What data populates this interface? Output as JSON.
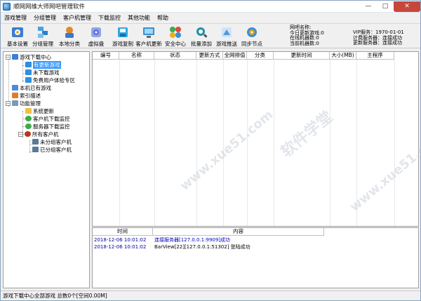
{
  "window": {
    "title": "顺网网维大师网吧管理软件"
  },
  "menu": [
    "游戏管理",
    "分组管理",
    "客户机管理",
    "下载监控",
    "其他功能",
    "帮助"
  ],
  "toolbar": {
    "buttons": [
      {
        "label": "基本设置",
        "icon": "gear-icon",
        "color": "#3b7dd8"
      },
      {
        "label": "分组管理",
        "icon": "group-icon",
        "color": "#4aa0e0"
      },
      {
        "label": "本地分类",
        "icon": "category-icon",
        "color": "#e08a2c"
      },
      {
        "label": "虚拟盘",
        "icon": "disk-icon",
        "color": "#6b6bd6"
      },
      {
        "label": "游戏复制",
        "icon": "copy-icon",
        "color": "#2fa8e0"
      },
      {
        "label": "客户机更新",
        "icon": "monitor-icon",
        "color": "#3a8fd0"
      },
      {
        "label": "安全中心",
        "icon": "shield-icon",
        "color": "#3cab4a"
      },
      {
        "label": "批量添加",
        "icon": "batch-add-icon",
        "color": "#1f8fa0"
      },
      {
        "label": "游戏推送",
        "icon": "push-icon",
        "color": "#4f9ad8"
      },
      {
        "label": "同步节点",
        "icon": "sync-icon",
        "color": "#d8a020"
      }
    ]
  },
  "stats_left": [
    "网吧名称:",
    "今日更新游戏:0",
    "在线机器数:0",
    "当前机器数:0"
  ],
  "stats_right": [
    "VIP服务：1970-01-01",
    "计费服务器：连接成功",
    "更新服务器：连接成功"
  ],
  "tree": {
    "root": "游戏下载中心",
    "root_children": [
      "有更新游戏",
      "未下载游戏",
      "免费用户体验专区"
    ],
    "local": "本机已有游戏",
    "index": "索引描述",
    "func": "功能管理",
    "func_children": [
      "系统更新",
      "客户机下载监控",
      "服务器下载监控"
    ],
    "clients": "所有客户机",
    "client_children": [
      "未分组客户机",
      "已分组客户机"
    ]
  },
  "main_columns": [
    "编号",
    "名称",
    "状态",
    "更新方式",
    "全网排值",
    "分类",
    "更新时间",
    "大小(MB)",
    "主程序"
  ],
  "log_columns": [
    "时间",
    "内容"
  ],
  "log_rows": [
    {
      "time": "2018-12-06  10:01:02",
      "msg": "连接服务器[127.0.0.1:9909]成功"
    },
    {
      "time": "2018-12-06  10:01:02",
      "msg": "BarView[22][127.0.0.1:51302] 登陆成功"
    }
  ],
  "status": "游戏下载中心全部游戏 总数0个[空间0.00M]",
  "watermark": [
    "软件学堂",
    "www.xue51.com"
  ]
}
